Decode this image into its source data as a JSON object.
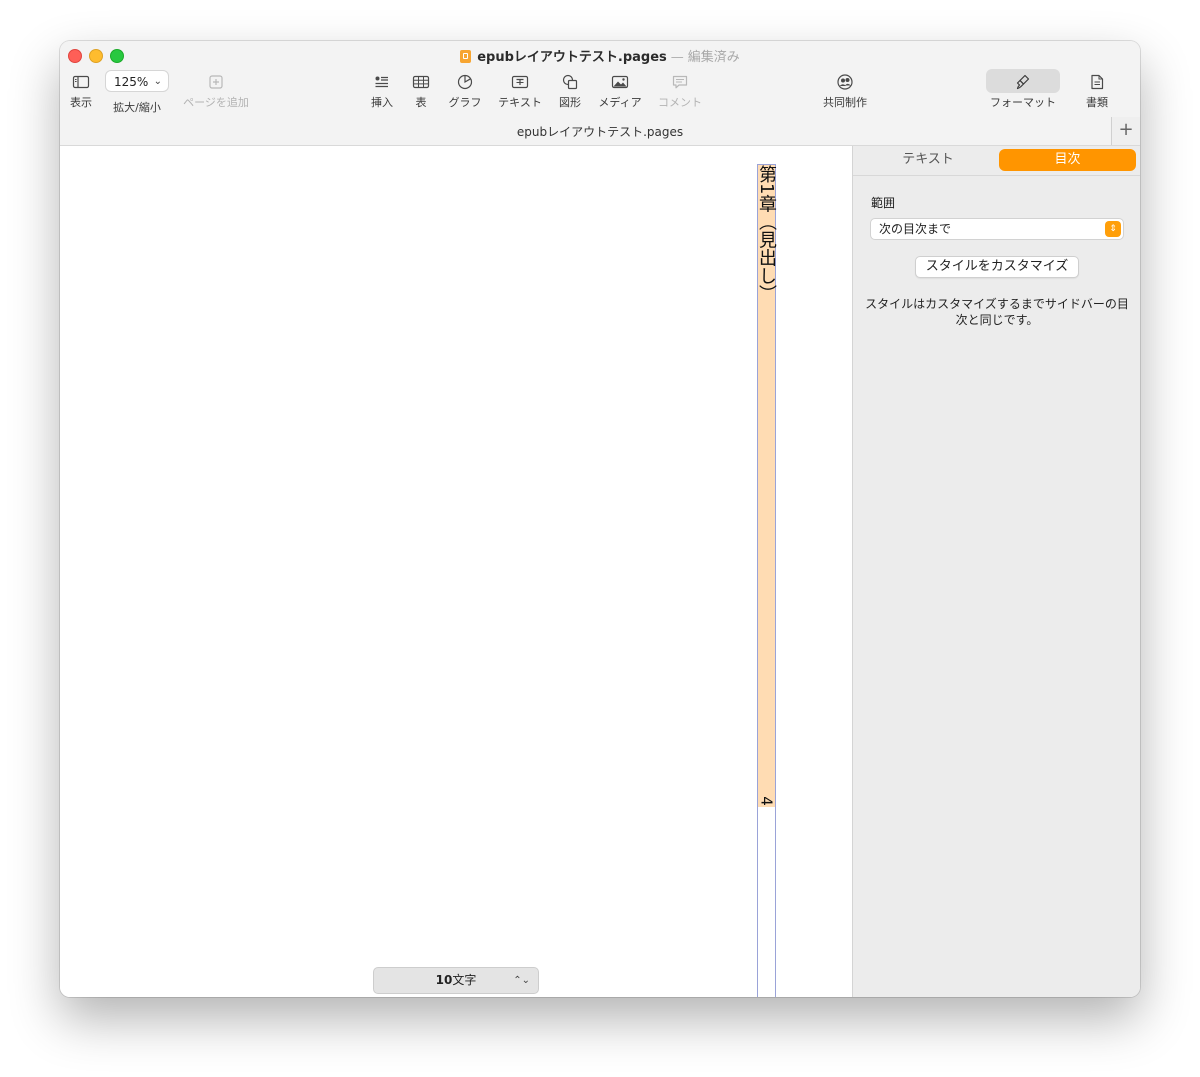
{
  "window": {
    "file_name": "epubレイアウトテスト.pages",
    "separator": "—",
    "status": "編集済み",
    "doc_tab_title": "epubレイアウトテスト.pages",
    "new_tab": "+"
  },
  "toolbar": {
    "view_label": "表示",
    "zoom_value": "125%",
    "zoom_chevron": "⌄",
    "zoom_label": "拡大/縮小",
    "add_page_label": "ページを追加",
    "insert_label": "挿入",
    "table_label": "表",
    "chart_label": "グラフ",
    "text_label": "テキスト",
    "shape_label": "図形",
    "media_label": "メディア",
    "comment_label": "コメント",
    "collaborate_label": "共同制作",
    "format_label": "フォーマット",
    "document_label": "書類"
  },
  "canvas": {
    "heading": "第1章（見出し）",
    "page_number": "4"
  },
  "wordcount": {
    "count": "10",
    "unit": "文字",
    "stepper": "⌃⌄"
  },
  "sidebar": {
    "tab_text": "テキスト",
    "tab_toc": "目次",
    "range_label": "範囲",
    "range_value": "次の目次まで",
    "customize_button": "スタイルをカスタマイズ",
    "note": "スタイルはカスタマイズするまでサイドバーの目次と同じです。"
  },
  "colors": {
    "accent": "#ff9500",
    "heading_fill": "#ffdcb3",
    "column_guide": "#9aa3d8"
  },
  "icons": {
    "view": "sidebar-icon",
    "add_page": "plus-square-icon",
    "insert": "paragraph-list-icon",
    "table": "table-icon",
    "chart": "pie-chart-icon",
    "text": "text-box-icon",
    "shape": "shapes-icon",
    "media": "photo-icon",
    "comment": "comment-icon",
    "collaborate": "people-icon",
    "format": "paintbrush-icon",
    "document": "document-icon"
  }
}
